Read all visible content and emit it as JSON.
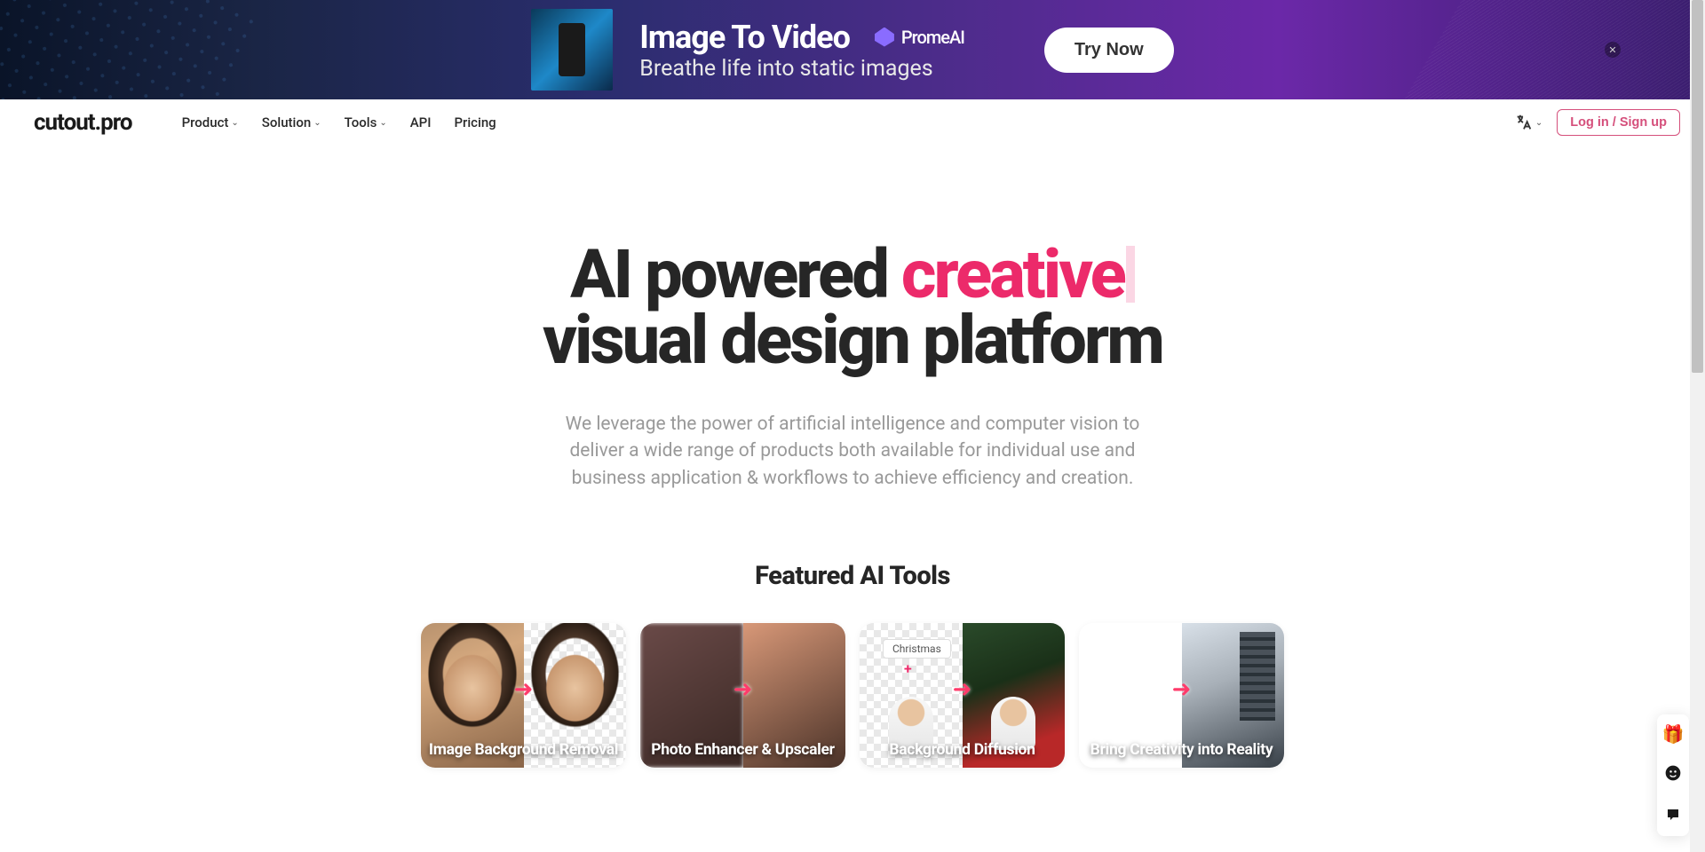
{
  "banner": {
    "title": "Image To Video",
    "subtitle": "Breathe life into static images",
    "brand": "PromeAI",
    "cta": "Try Now"
  },
  "nav": {
    "logo": "cutout.pro",
    "items": [
      {
        "label": "Product",
        "dropdown": true
      },
      {
        "label": "Solution",
        "dropdown": true
      },
      {
        "label": "Tools",
        "dropdown": true
      },
      {
        "label": "API",
        "dropdown": false
      },
      {
        "label": "Pricing",
        "dropdown": false
      }
    ],
    "login": "Log in / Sign up"
  },
  "hero": {
    "line1_prefix": "AI powered ",
    "line1_highlight": "creative",
    "line2": "visual design platform",
    "subtitle": "We leverage the power of artificial intelligence and computer vision to deliver a wide range of products both available for individual use and business application & workflows to achieve efficiency and creation."
  },
  "featured": {
    "title": "Featured AI Tools",
    "cards": [
      {
        "label": "Image Background Removal"
      },
      {
        "label": "Photo Enhancer & Upscaler"
      },
      {
        "label": "Background Diffusion",
        "tag": "Christmas"
      },
      {
        "label": "Bring Creativity into Reality"
      }
    ]
  }
}
